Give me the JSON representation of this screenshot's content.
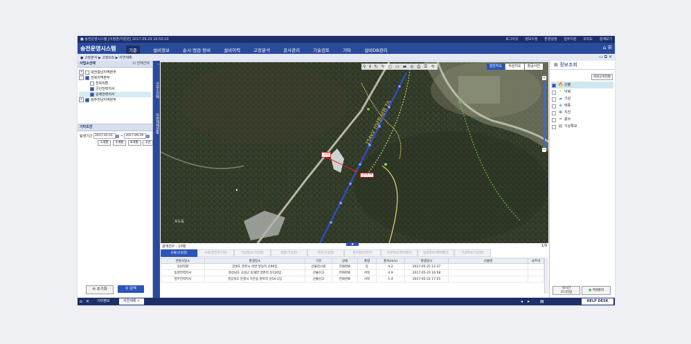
{
  "topbar": {
    "left": "■ 송전운영시스템 [이정훈/지원원] 2017.09.29 16:50:10",
    "right": [
      "로그아웃",
      "정보수정",
      "환경설정",
      "업무지원",
      "조직도",
      "설계보기"
    ]
  },
  "nav": {
    "brand": "송전운영시스템",
    "menu": [
      "기준",
      "설비정보",
      "순시·점검·정비",
      "설비이력",
      "고장분석",
      "공사관리",
      "기술검토",
      "기타",
      "설비DB관리"
    ]
  },
  "breadcrumb": "● 고장분석 ▶ 고장GIS ▶ 자연재해",
  "left": {
    "section_title": "사업소선택",
    "check_all": "전체선택",
    "tree": [
      {
        "label": "대전충남지역본부",
        "level": 0,
        "checked": false,
        "expanded": false
      },
      {
        "label": "전북지역본부",
        "level": 0,
        "checked": true,
        "expanded": true
      },
      {
        "label": "전북직할",
        "level": 1,
        "checked": false,
        "selected": false
      },
      {
        "label": "군산전력지사",
        "level": 1,
        "checked": true,
        "selected": false
      },
      {
        "label": "김제전력지사",
        "level": 1,
        "checked": true,
        "selected": true
      },
      {
        "label": "광주전남지역본부",
        "level": 0,
        "checked": true,
        "expanded": false
      }
    ],
    "condition_title": "기타조건",
    "period_label": "발생기간",
    "date_from": "2017.05.01",
    "date_to": "2017.09.29",
    "period_buttons": [
      "1개월",
      "3개월",
      "6개월",
      "1년"
    ],
    "reset_label": "초기화",
    "search_label": "검색"
  },
  "vtabs": [
    "사업소선택",
    "자연재해현황"
  ],
  "map": {
    "toolbar": [
      "⚲",
      "ℹ",
      "↻",
      "✎",
      "▢",
      "▭",
      "▬",
      "◎",
      "⎙",
      "☰",
      "⟲"
    ],
    "map_types": [
      {
        "label": "일반지도",
        "on": true
      },
      {
        "label": "위성지도",
        "on": false
      },
      {
        "label": "항공사진",
        "on": false
      }
    ],
    "start_label": "시작",
    "distance_label": "314 m",
    "line_label": "154kV 신남원-남원 T/L",
    "place_label": "포도동"
  },
  "grid": {
    "count": "검색건수 : 10행",
    "page": "1/9",
    "tabs": [
      "산불(산림청)",
      "낙뢰(한전연구원)",
      "기상정보(기상청)",
      "태풍(기상청)",
      "지진(기상청)",
      "홍수정보(한전)",
      "기상특보(케이웨더)",
      "날씨정보(케이웨더)",
      "기상특보(기상청)"
    ],
    "columns": [
      "관할사업소",
      "발생장소",
      "구분",
      "상태",
      "풍향",
      "풍속(m/s)",
      "발생일시",
      "산불명",
      "요주의"
    ],
    "rows": [
      [
        "강원직할",
        "강원도 춘천시 서면 방동리 산90임",
        "산불감시원",
        "진화완료",
        "동",
        "4.2",
        "2017-05-25 12:37",
        "",
        ""
      ],
      [
        "동영전력지사",
        "경상남도 고성군 동해면 양촌리 산120임",
        "산불신고",
        "진화완료",
        "서북",
        "4.9",
        "2017-05-23 16:58",
        "",
        ""
      ],
      [
        "영주전력지사",
        "경상북도 문경시 가은읍 원북리 산54-1임",
        "산불신고",
        "진화완료",
        "서북",
        "1.4",
        "2017-05-22 17:25",
        "",
        ""
      ]
    ]
  },
  "right": {
    "title": "정보조회",
    "legend_button": "위성군위현황",
    "items": [
      {
        "label": "산불",
        "icon": "fire-icon",
        "glyph": "🔥",
        "checked": true,
        "selected": true
      },
      {
        "label": "낙뢰",
        "icon": "lightning-icon",
        "glyph": "⚡",
        "checked": false,
        "selected": false
      },
      {
        "label": "기상",
        "icon": "cloud-icon",
        "glyph": "☁",
        "checked": false,
        "selected": false
      },
      {
        "label": "태풍",
        "icon": "typhoon-icon",
        "glyph": "◈",
        "checked": false,
        "selected": false
      },
      {
        "label": "지진",
        "icon": "earthquake-icon",
        "glyph": "⊛",
        "checked": false,
        "selected": false
      },
      {
        "label": "홍수",
        "icon": "flood-icon",
        "glyph": "≈",
        "checked": false,
        "selected": false
      },
      {
        "label": "기상특보",
        "icon": "warning-icon",
        "glyph": "▤",
        "checked": false,
        "selected": false
      }
    ],
    "btn_realtime": "실시간\n모니터링",
    "btn_print": "엑셀출력"
  },
  "status": {
    "tabs": [
      {
        "label": "기타정보",
        "on": false
      },
      {
        "label": "자연재해",
        "on": true
      }
    ],
    "helpdesk": "HELP DESK"
  },
  "colors": {
    "navy": "#1c2f6b",
    "accent": "#2b54b8",
    "selected_row": "#cfe8ef"
  }
}
